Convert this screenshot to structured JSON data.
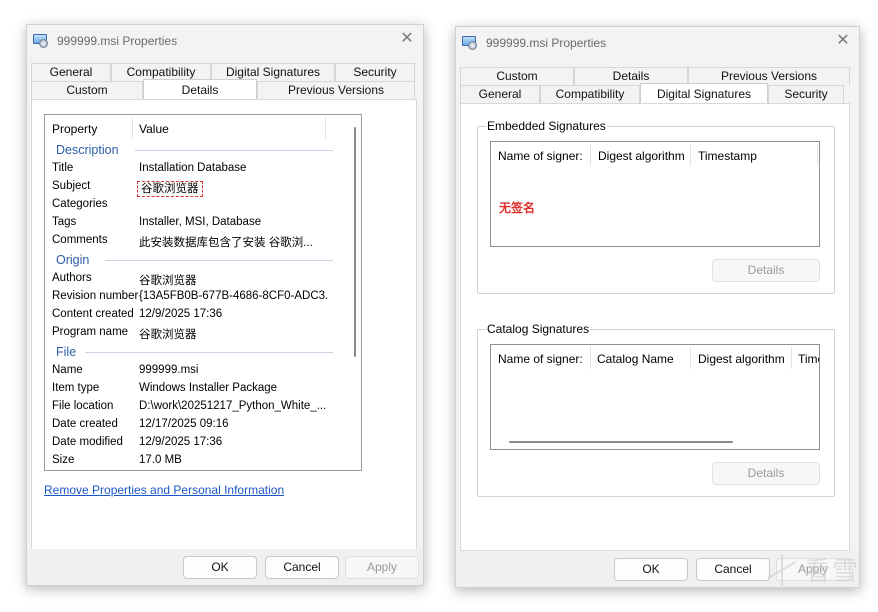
{
  "left_dialog": {
    "title": "999999.msi Properties",
    "close_glyph": "✕",
    "tabs_row1": [
      "General",
      "Compatibility",
      "Digital Signatures",
      "Security"
    ],
    "tabs_row2": [
      "Custom",
      "Details",
      "Previous Versions"
    ],
    "selected_tab": "Details",
    "columns": {
      "property": "Property",
      "value": "Value"
    },
    "sections": {
      "description": {
        "label": "Description",
        "rows": [
          {
            "k": "Title",
            "v": "Installation Database"
          },
          {
            "k": "Subject",
            "v": "谷歌浏览器"
          },
          {
            "k": "Categories",
            "v": ""
          },
          {
            "k": "Tags",
            "v": "Installer, MSI, Database"
          },
          {
            "k": "Comments",
            "v": "此安装数据库包含了安装 谷歌浏..."
          }
        ]
      },
      "origin": {
        "label": "Origin",
        "rows": [
          {
            "k": "Authors",
            "v": "谷歌浏览器"
          },
          {
            "k": "Revision number",
            "v": "{13A5FB0B-677B-4686-8CF0-ADC3..."
          },
          {
            "k": "Content created",
            "v": "12/9/2025 17:36"
          },
          {
            "k": "Program name",
            "v": "谷歌浏览器"
          }
        ]
      },
      "file": {
        "label": "File",
        "rows": [
          {
            "k": "Name",
            "v": "999999.msi"
          },
          {
            "k": "Item type",
            "v": "Windows Installer Package"
          },
          {
            "k": "File location",
            "v": "D:\\work\\20251217_Python_White_..."
          },
          {
            "k": "Date created",
            "v": "12/17/2025 09:16"
          },
          {
            "k": "Date modified",
            "v": "12/9/2025 17:36"
          },
          {
            "k": "Size",
            "v": "17.0 MB"
          }
        ]
      }
    },
    "remove_link": "Remove Properties and Personal Information",
    "buttons": {
      "ok": "OK",
      "cancel": "Cancel",
      "apply": "Apply"
    }
  },
  "right_dialog": {
    "title": "999999.msi Properties",
    "close_glyph": "✕",
    "tabs_row1": [
      "Custom",
      "Details",
      "Previous Versions"
    ],
    "tabs_row2": [
      "General",
      "Compatibility",
      "Digital Signatures",
      "Security"
    ],
    "selected_tab": "Digital Signatures",
    "embedded": {
      "label": "Embedded Signatures",
      "columns": [
        "Name of signer:",
        "Digest algorithm",
        "Timestamp"
      ],
      "empty_text": "无签名",
      "details_button": "Details"
    },
    "catalog": {
      "label": "Catalog Signatures",
      "columns": [
        "Name of signer:",
        "Catalog Name",
        "Digest algorithm",
        "Time"
      ],
      "details_button": "Details"
    },
    "buttons": {
      "ok": "OK",
      "cancel": "Cancel",
      "apply": "Apply"
    }
  },
  "watermark": {
    "text": "看雪"
  },
  "colors": {
    "accent": "#2b5ea6",
    "link": "#1a57c6",
    "error": "#e0302c",
    "highlight": "#d43030"
  }
}
